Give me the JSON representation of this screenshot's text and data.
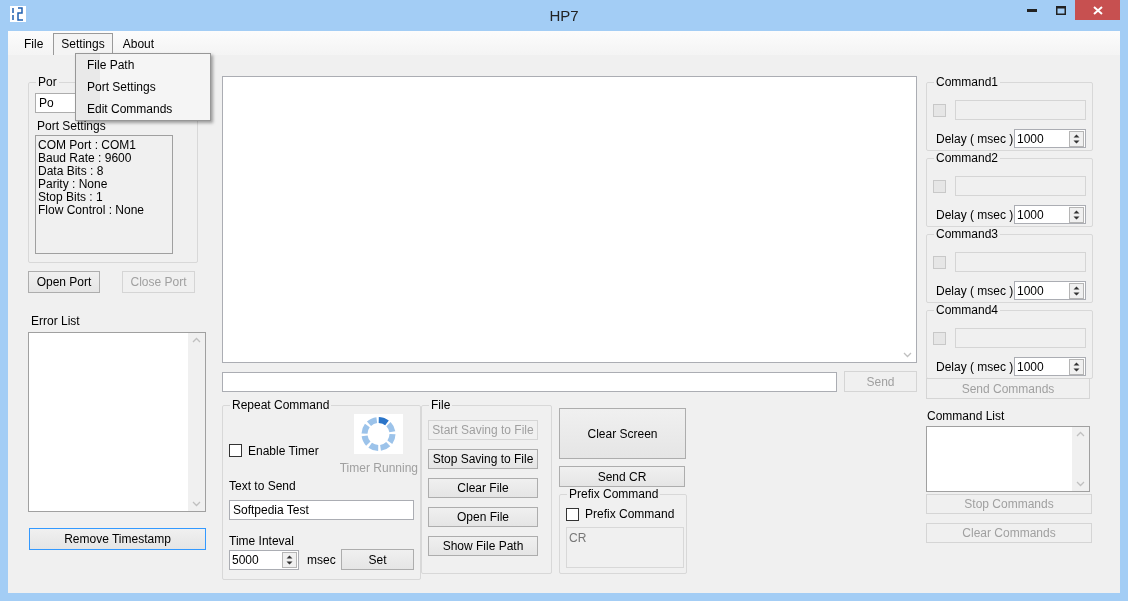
{
  "window": {
    "title": "HP7"
  },
  "menu": [
    {
      "label": "File",
      "selected": false
    },
    {
      "label": "Settings",
      "selected": true
    },
    {
      "label": "About",
      "selected": false
    }
  ],
  "open_menu": {
    "items": [
      "File Path",
      "Port Settings",
      "Edit Commands"
    ]
  },
  "port_group": {
    "title": "Por",
    "port_select": "Po",
    "settings_label": "Port Settings",
    "settings_lines": [
      "COM Port : COM1",
      "Baud Rate : 9600",
      "Data Bits : 8",
      "Parity : None",
      "Stop Bits : 1",
      "Flow Control : None"
    ],
    "buttons": [
      {
        "label": "Open Port",
        "disabled": false
      },
      {
        "label": "Close Port",
        "disabled": true
      }
    ]
  },
  "error_list": {
    "label": "Error List"
  },
  "remove_timestamp": {
    "label": "Remove Timestamp",
    "focused": true
  },
  "send_button": {
    "label": "Send",
    "disabled": true
  },
  "repeat_command": {
    "title": "Repeat Command",
    "enable_timer": {
      "label": "Enable Timer",
      "checked": false
    },
    "timer_status": {
      "label": "Timer Running",
      "disabled": true
    },
    "text_label": "Text to Send",
    "text_value": "Softpedia Test",
    "interval_label": "Time Inteval",
    "interval_value": "5000",
    "unit": "msec",
    "set_button": "Set"
  },
  "file_group": {
    "title": "File",
    "buttons": [
      {
        "label": "Start Saving to File",
        "disabled": true
      },
      {
        "label": "Stop Saving to File",
        "disabled": false
      },
      {
        "label": "Clear File",
        "disabled": false
      },
      {
        "label": "Open File",
        "disabled": false
      },
      {
        "label": "Show File Path",
        "disabled": false
      }
    ]
  },
  "clear_screen_button": "Clear Screen",
  "send_cr_button": "Send CR",
  "prefix_group": {
    "title": "Prefix Command",
    "checkbox": {
      "label": "Prefix Command",
      "checked": false
    },
    "value": "CR",
    "disabled": true
  },
  "commands": [
    {
      "title": "Command1",
      "checked": false,
      "disabled": true,
      "delay_label": "Delay ( msec )",
      "delay": "1000"
    },
    {
      "title": "Command2",
      "checked": false,
      "disabled": true,
      "delay_label": "Delay ( msec )",
      "delay": "1000"
    },
    {
      "title": "Command3",
      "checked": false,
      "disabled": true,
      "delay_label": "Delay ( msec )",
      "delay": "1000"
    },
    {
      "title": "Command4",
      "checked": false,
      "disabled": true,
      "delay_label": "Delay ( msec )",
      "delay": "1000"
    }
  ],
  "command_panel": {
    "send_button": {
      "label": "Send Commands",
      "disabled": true
    },
    "list_label": "Command List",
    "buttons": [
      {
        "label": "Stop Commands",
        "disabled": true
      },
      {
        "label": "Clear Commands",
        "disabled": true
      }
    ]
  }
}
